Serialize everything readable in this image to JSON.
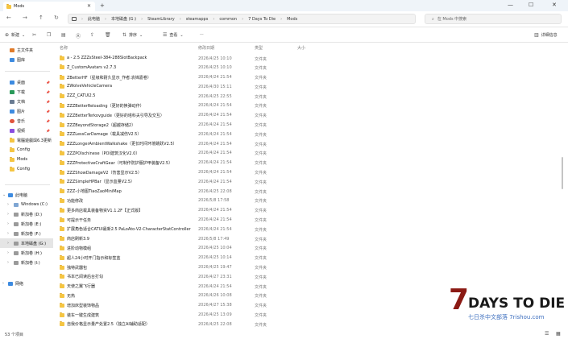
{
  "window": {
    "tab_title": "Mods",
    "close_tab": "✕",
    "new_tab": "+",
    "minimize": "—",
    "maximize": "☐",
    "close": "✕"
  },
  "nav": {
    "back": "←",
    "forward": "→",
    "up": "↑",
    "refresh": "↻",
    "breadcrumbs": [
      "此电脑",
      "本地磁盘 (G:)",
      "SteamLibrary",
      "steamapps",
      "common",
      "7 Days To Die",
      "Mods"
    ],
    "search_placeholder": "在 Mods 中搜索"
  },
  "toolbar": {
    "new": "新建",
    "sort": "排序",
    "view": "查看",
    "more": "···",
    "details": "详细信息"
  },
  "sidebar": {
    "quick": [
      {
        "label": "主文件夹",
        "icon": "home-icon",
        "color": "#e07b2a"
      },
      {
        "label": "图库",
        "icon": "gallery-icon",
        "color": "#3d8be0"
      }
    ],
    "pinned": [
      {
        "label": "桌面",
        "icon": "desktop-icon",
        "color": "#3d8be0"
      },
      {
        "label": "下载",
        "icon": "download-icon",
        "color": "#2a9a5a"
      },
      {
        "label": "文档",
        "icon": "document-icon",
        "color": "#6a7c92"
      },
      {
        "label": "图片",
        "icon": "pictures-icon",
        "color": "#3d8be0"
      },
      {
        "label": "音乐",
        "icon": "music-icon",
        "color": "#e0543d"
      },
      {
        "label": "视频",
        "icon": "video-icon",
        "color": "#8a4de0"
      },
      {
        "label": "電腦遊戲與6.3更新",
        "icon": "folder-icon",
        "color": "#f5c542"
      },
      {
        "label": "Config",
        "icon": "folder-icon",
        "color": "#f5c542"
      },
      {
        "label": "Mods",
        "icon": "folder-icon",
        "color": "#f5c542"
      },
      {
        "label": "Config",
        "icon": "folder-icon",
        "color": "#f5c542"
      }
    ],
    "pc_label": "此电脑",
    "drives": [
      {
        "label": "Windows (C:)"
      },
      {
        "label": "新加卷 (D:)"
      },
      {
        "label": "新加卷 (E:)"
      },
      {
        "label": "新加卷 (F:)"
      },
      {
        "label": "本地磁盘 (G:)"
      },
      {
        "label": "新加卷 (H:)"
      },
      {
        "label": "新加卷 (I:)"
      }
    ],
    "network_label": "网络"
  },
  "columns": {
    "name": "名称",
    "date": "修改日期",
    "type": "类型",
    "size": "大小"
  },
  "files": [
    {
      "name": "a - 2.5 ZZZsSteel-384-288SlotBackpack",
      "date": "2026/4/25 10:10",
      "type": "文件夹"
    },
    {
      "name": "Z_CustomAvatars v2.7.3",
      "date": "2026/4/25 10:10",
      "type": "文件夹"
    },
    {
      "name": "ZBetterHF（星级和耐久显示_作者:袁锦嘉卷）",
      "date": "2026/4/24 21:54",
      "type": "文件夹"
    },
    {
      "name": "ZWolveVehicleCamera",
      "date": "2026/4/30 15:11",
      "type": "文件夹"
    },
    {
      "name": "ZZZ_CATUI2.5",
      "date": "2026/4/25 22:55",
      "type": "文件夹"
    },
    {
      "name": "ZZZBetterReloading（更好的换弹动作）",
      "date": "2026/4/24 21:54",
      "type": "文件夹"
    },
    {
      "name": "ZZZBetterTerkovguide（更好的塔科夫引导及交互）",
      "date": "2026/4/24 21:54",
      "type": "文件夹"
    },
    {
      "name": "ZZZBeyondStorage2（超越存储2）",
      "date": "2026/4/24 21:54",
      "type": "文件夹"
    },
    {
      "name": "ZZZLessCarDamage（载具减伤V2.5）",
      "date": "2026/4/24 21:54",
      "type": "文件夹"
    },
    {
      "name": "ZZZLongerAmbientWalkshake（更长时间环境跳跃V2.5）",
      "date": "2026/4/24 21:54",
      "type": "文件夹"
    },
    {
      "name": "ZZZPOIschinese（POI建筑汉化V2.0）",
      "date": "2026/4/24 21:54",
      "type": "文件夹"
    },
    {
      "name": "ZZZProtectiveCraftGear（可制作防护服护甲装备V2.5）",
      "date": "2026/4/24 21:54",
      "type": "文件夹"
    },
    {
      "name": "ZZZShowDamageV2（伤害显示V2.5）",
      "date": "2026/4/24 21:54",
      "type": "文件夹"
    },
    {
      "name": "ZZZSimpleHPBar（显示血量V2.5）",
      "date": "2026/4/24 21:54",
      "type": "文件夹"
    },
    {
      "name": "ZZZ-小地图TiaoZaoMiniMap",
      "date": "2026/4/25 22:08",
      "type": "文件夹"
    },
    {
      "name": "功能修改",
      "date": "2026/5/8 17:58",
      "type": "文件夹"
    },
    {
      "name": "更多商店载具装备物资V1.1.2F【正式版】",
      "date": "2026/4/24 21:54",
      "type": "文件夹"
    },
    {
      "name": "可提示干任务",
      "date": "2026/4/24 21:54",
      "type": "文件夹"
    },
    {
      "name": "扩展角色适合CATUI最新2.5 PaLoAto-V2-CharacterStatController",
      "date": "2026/4/24 21:54",
      "type": "文件夹"
    },
    {
      "name": "商店刷新3.9",
      "date": "2026/5/8 17:49",
      "type": "文件夹"
    },
    {
      "name": "进阶动物模组",
      "date": "2026/4/25 10:04",
      "type": "文件夹"
    },
    {
      "name": "超人24小时开门指示和标签蓝",
      "date": "2026/4/25 10:14",
      "type": "文件夹"
    },
    {
      "name": "独特武器包",
      "date": "2026/4/25 19:47",
      "type": "文件夹"
    },
    {
      "name": "书本已阅读后台打勾",
      "date": "2026/4/27 23:31",
      "type": "文件夹"
    },
    {
      "name": "天使之翼飞行器",
      "date": "2026/4/24 21:54",
      "type": "文件夹"
    },
    {
      "name": "无热",
      "date": "2026/4/26 10:08",
      "type": "文件夹"
    },
    {
      "name": "增加床型装饰物品",
      "date": "2026/4/27 15:38",
      "type": "文件夹"
    },
    {
      "name": "装车一键生成建筑",
      "date": "2026/4/25 13:09",
      "type": "文件夹"
    },
    {
      "name": "自我价格显示量产处置2.5（独立AI辅助适配）",
      "date": "2026/4/25 22:08",
      "type": "文件夹"
    }
  ],
  "status": {
    "count": "53 个项目"
  },
  "watermark": {
    "title": "7 DAYS TO DIE",
    "sub": "七日杀中文部落 7rishou.com"
  },
  "colors": {
    "folder": "#f5c542",
    "accent": "#0067c0",
    "selected": "#e5e5e5"
  }
}
